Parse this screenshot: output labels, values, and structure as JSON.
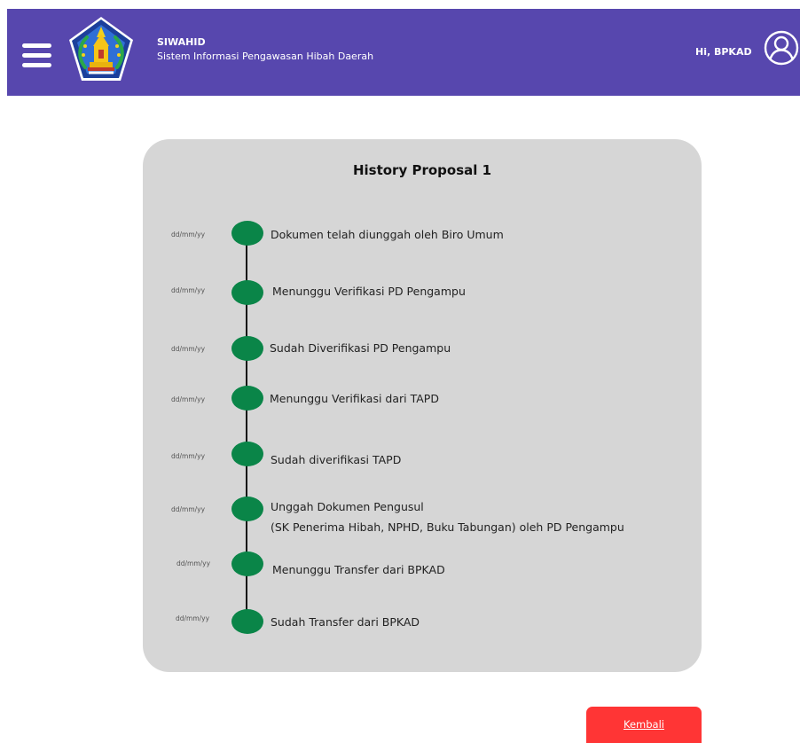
{
  "header": {
    "app_name": "SIWAHID",
    "app_subtitle": "Sistem Informasi Pengawasan Hibah Daerah",
    "greeting": "Hi, BPKAD",
    "menu_icon": "hamburger-menu-icon",
    "logo": "government-emblem-logo",
    "user_icon": "user-profile-icon"
  },
  "history": {
    "title": "History Proposal 1",
    "events": [
      {
        "date": "dd/mm/yy",
        "label": "Dokumen telah diunggah oleh Biro Umum"
      },
      {
        "date": "dd/mm/yy",
        "label": "Menunggu Verifikasi PD Pengampu"
      },
      {
        "date": "dd/mm/yy",
        "label": "Sudah Diverifikasi PD Pengampu"
      },
      {
        "date": "dd/mm/yy",
        "label": "Menunggu Verifikasi dari TAPD"
      },
      {
        "date": "dd/mm/yy",
        "label": "Sudah diverifikasi TAPD"
      },
      {
        "date": "dd/mm/yy",
        "label": "Unggah Dokumen Pengusul",
        "sublabel": "(SK Penerima Hibah, NPHD, Buku Tabungan) oleh PD Pengampu"
      },
      {
        "date": "dd/mm/yy",
        "label": "Menunggu Transfer dari BPKAD"
      },
      {
        "date": "dd/mm/yy",
        "label": "Sudah Transfer dari BPKAD"
      }
    ]
  },
  "actions": {
    "back_label": "Kembali"
  },
  "colors": {
    "header_bg": "#5747ae",
    "card_bg": "#d6d6d6",
    "dot": "#0a8548",
    "back_button": "#ff3535"
  }
}
